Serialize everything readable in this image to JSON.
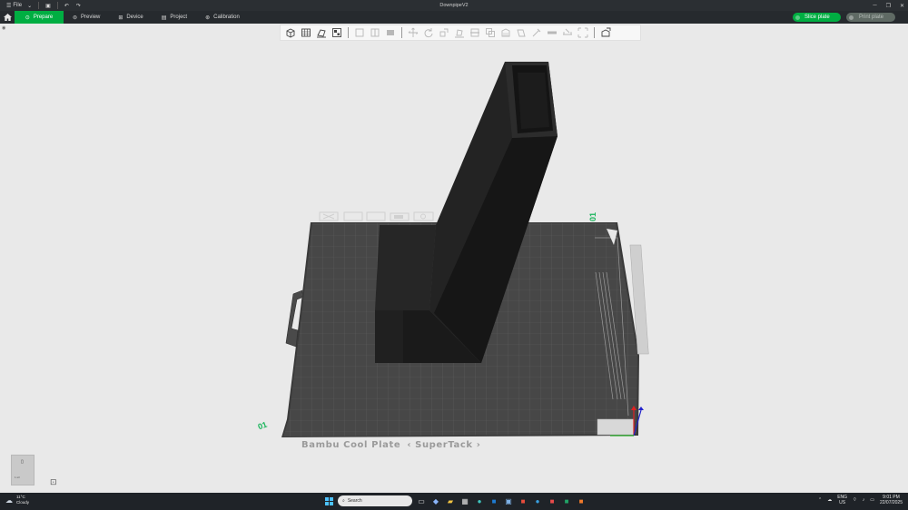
{
  "window": {
    "title": "DownpipeV2",
    "file_menu": "File"
  },
  "nav": {
    "tabs": [
      {
        "label": "Prepare",
        "icon": "prepare-icon",
        "active": true
      },
      {
        "label": "Preview",
        "icon": "preview-icon",
        "active": false
      },
      {
        "label": "Device",
        "icon": "device-icon",
        "active": false
      },
      {
        "label": "Project",
        "icon": "project-icon",
        "active": false
      },
      {
        "label": "Calibration",
        "icon": "calibration-icon",
        "active": false
      }
    ],
    "slice_label": "Slice plate",
    "print_label": "Print plate"
  },
  "toolbar": {
    "icons": [
      "add-icon",
      "add-plate-icon",
      "auto-orient-icon",
      "arrange-icon",
      "split-objects-icon",
      "split-parts-icon",
      "layers-icon",
      "move-icon",
      "rotate-icon",
      "scale-icon",
      "lay-on-face-icon",
      "cut-icon",
      "mesh-boolean-icon",
      "support-paint-icon",
      "seam-paint-icon",
      "color-paint-icon",
      "text-icon",
      "measure-icon",
      "assembly-icon",
      "variable-height-icon"
    ]
  },
  "plate": {
    "name": "Bambu Cool Plate",
    "type_label": "SuperTack",
    "number_left": "01",
    "number_top": "01",
    "thumb_label": "1.stl"
  },
  "colors": {
    "accent": "#00ae42",
    "plate": "#474747",
    "grid": "#5c5c5c",
    "model": "#202020"
  },
  "taskbar": {
    "weather_temp": "11°C",
    "weather_desc": "Cloudy",
    "search_placeholder": "Search",
    "lang_top": "ENG",
    "lang_bottom": "US",
    "time": "9:01 PM",
    "date": "22/07/2025"
  }
}
